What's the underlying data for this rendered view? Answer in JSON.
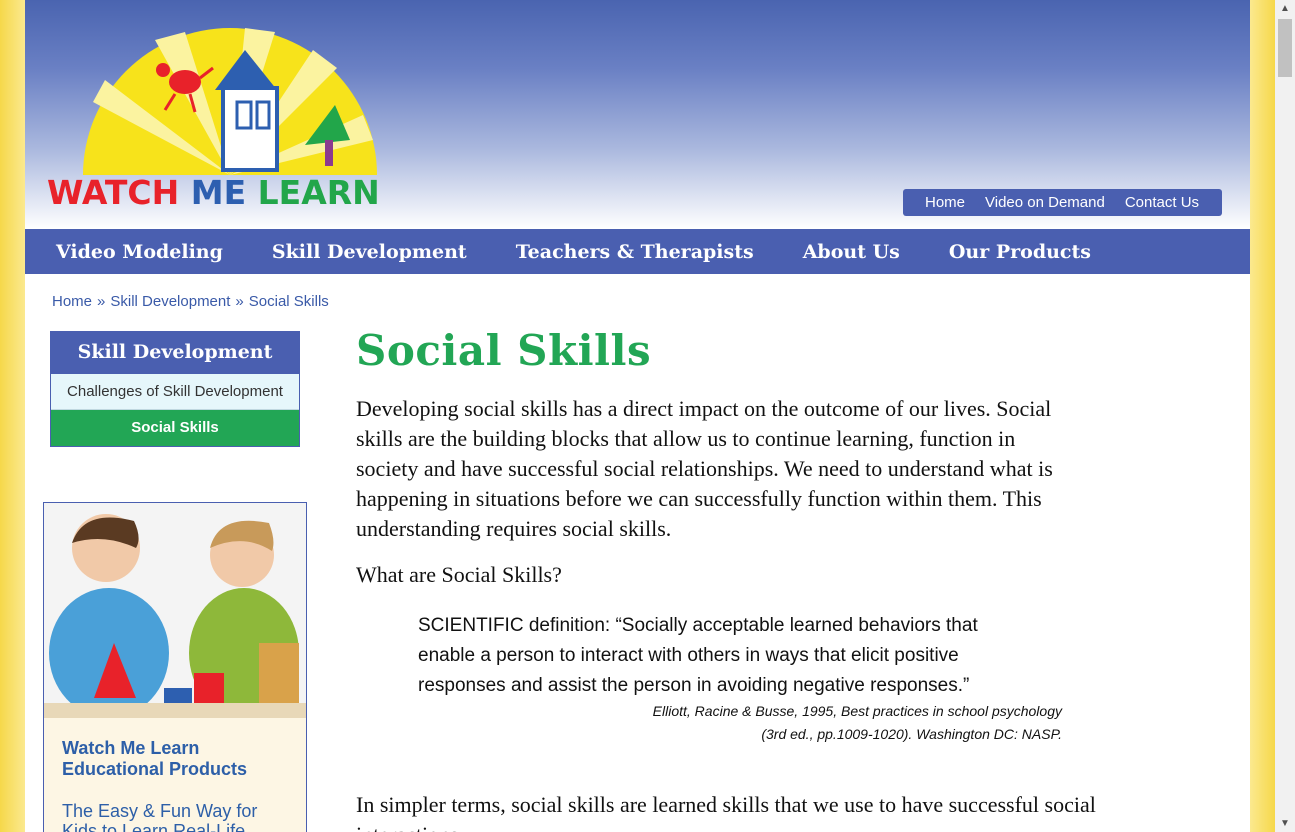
{
  "logo": {
    "word1": "WATCH",
    "word2": "ME",
    "word3": "LEARN"
  },
  "top_nav": [
    "Home",
    "Video on Demand",
    "Contact Us"
  ],
  "main_nav": [
    "Video Modeling",
    "Skill Development",
    "Teachers & Therapists",
    "About Us",
    "Our Products"
  ],
  "breadcrumb": {
    "items": [
      "Home",
      "Skill Development",
      "Social Skills"
    ],
    "separator": "»"
  },
  "sidebar": {
    "title": "Skill Development",
    "items": [
      "Challenges of Skill Development",
      "Social Skills"
    ]
  },
  "promo": {
    "title_line1": "Watch Me Learn",
    "title_line2": "Educational Products",
    "tagline_line1": "The Easy & Fun Way for",
    "tagline_line2": "Kids to Learn Real-Life"
  },
  "main": {
    "title": "Social Skills",
    "intro": "Developing social skills has a direct impact on the outcome of our lives. Social skills are the building blocks that allow us to continue learning, function in society and have successful social relationships. We need to understand what is happening in situations before we can successfully function within them. This understanding requires social skills.",
    "question": "What are Social Skills?",
    "quote": "SCIENTIFIC definition: “Socially acceptable learned behaviors that enable a person to interact with others in ways that elicit positive responses and assist the person in avoiding negative responses.”",
    "citation_line1": "Elliott, Racine & Busse, 1995, Best practices in school psychology",
    "citation_line2": "(3rd ed., pp.1009-1020). Washington DC: NASP.",
    "simpler": "In simpler terms, social skills are learned skills that we use to have successful social interactions."
  },
  "colors": {
    "nav_blue": "#4a5fb0",
    "title_green": "#22a655",
    "highlight_green": "#22a655"
  }
}
